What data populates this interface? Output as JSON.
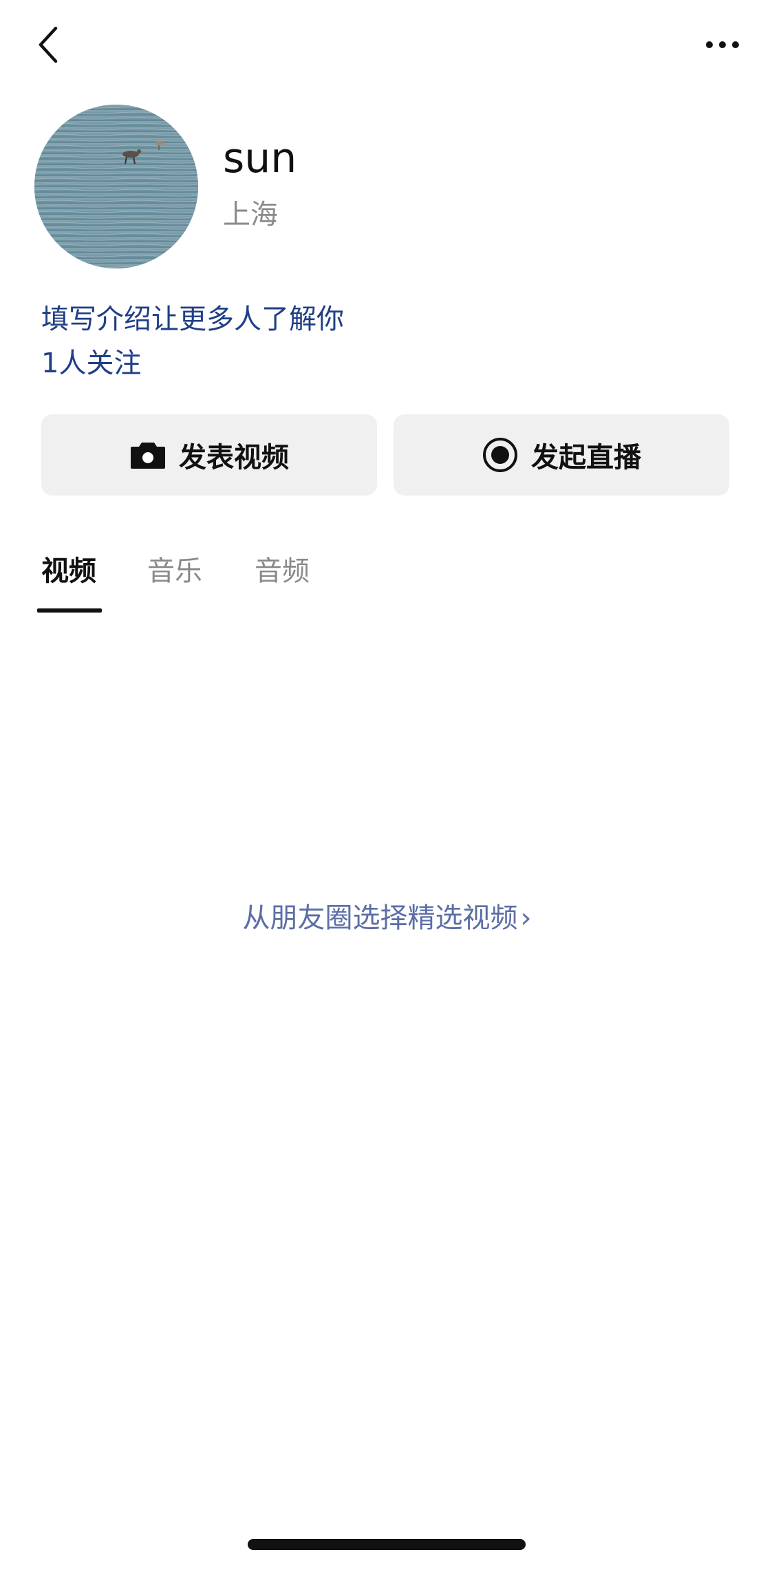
{
  "header": {
    "back_icon": "chevron-left-icon",
    "more_icon": "more-horizontal-icon"
  },
  "profile": {
    "name": "sun",
    "location": "上海",
    "intro_placeholder": "填写介绍让更多人了解你",
    "followers": "1人关注",
    "avatar": "avatar-image"
  },
  "actions": {
    "post_video_label": "发表视频",
    "post_video_icon": "camera-icon",
    "start_live_label": "发起直播",
    "start_live_icon": "live-record-icon"
  },
  "tabs": [
    {
      "label": "视频",
      "active": true
    },
    {
      "label": "音乐",
      "active": false
    },
    {
      "label": "音频",
      "active": false
    }
  ],
  "content": {
    "select_featured_video": "从朋友圈选择精选视频",
    "chevron": "›"
  },
  "colors": {
    "text_primary": "#111111",
    "text_secondary": "#8a8a8a",
    "link_blue": "#1f3f86",
    "muted_link": "#5b6ea6",
    "button_bg": "#f0f0f0"
  }
}
